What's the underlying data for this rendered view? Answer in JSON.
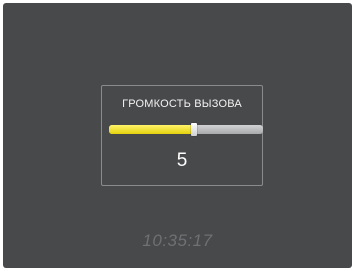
{
  "volume_dialog": {
    "title": "ГРОМКОСТЬ ВЫЗОВА",
    "value": "5",
    "level_fraction": 0.55
  },
  "status": {
    "time": "10:35:17"
  },
  "colors": {
    "background": "#48494b",
    "slider_fill": "#f2e22a",
    "slider_track": "#bdbec0",
    "text": "#ffffff",
    "clock_text": "#6f7073"
  }
}
